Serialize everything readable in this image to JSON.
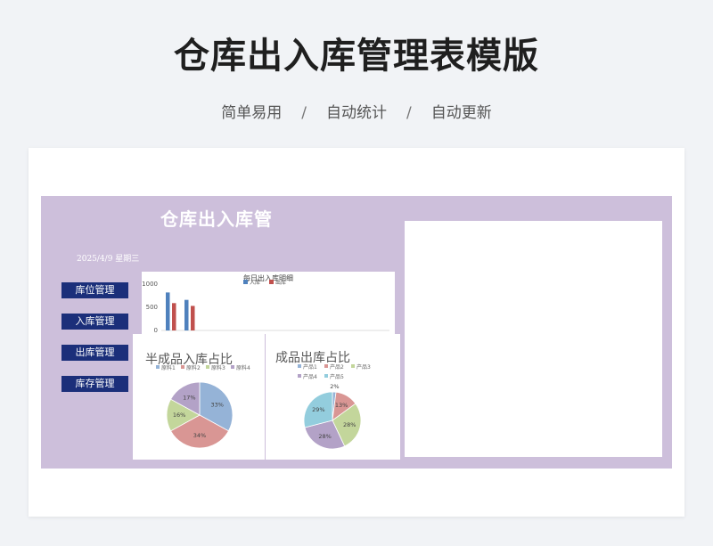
{
  "header": {
    "title": "仓库出入库管理表模版",
    "tags": [
      "简单易用",
      "自动统计",
      "自动更新"
    ],
    "separator": "/"
  },
  "sheet": {
    "title": "仓库出入库管",
    "date": "2025/4/9 星期三",
    "nav": [
      "库位管理",
      "入库管理",
      "出库管理",
      "库存管理"
    ]
  },
  "colors": {
    "sheet_bg": "#cdbfdb",
    "nav_bg": "#1b2f7a",
    "series_in": "#4f81bd",
    "series_out": "#c0504d",
    "pie": [
      "#95b3d7",
      "#d99694",
      "#c3d69b",
      "#b3a2c7",
      "#93cddd"
    ]
  },
  "chart_data": [
    {
      "type": "bar",
      "title": "每日出入库明细",
      "legend": [
        "入库",
        "出库"
      ],
      "ylim": [
        0,
        1000
      ],
      "yticks": [
        "1000",
        "500",
        "0"
      ],
      "series": [
        {
          "name": "入库",
          "values": [
            820,
            660
          ]
        },
        {
          "name": "出库",
          "values": [
            590,
            530
          ]
        }
      ]
    },
    {
      "type": "pie",
      "title": "半成品入库占比",
      "legend": [
        "原料1",
        "原料2",
        "原料3",
        "原料4"
      ],
      "values": [
        33,
        34,
        16,
        17
      ],
      "labels": [
        "33%",
        "34%",
        "16%",
        "17%"
      ]
    },
    {
      "type": "pie",
      "title": "成品出库占比",
      "legend": [
        "产品1",
        "产品2",
        "产品3",
        "产品4",
        "产品5"
      ],
      "values": [
        2,
        13,
        28,
        28,
        29
      ],
      "labels": [
        "2%",
        "13%",
        "28%",
        "28%",
        "29%"
      ]
    }
  ]
}
